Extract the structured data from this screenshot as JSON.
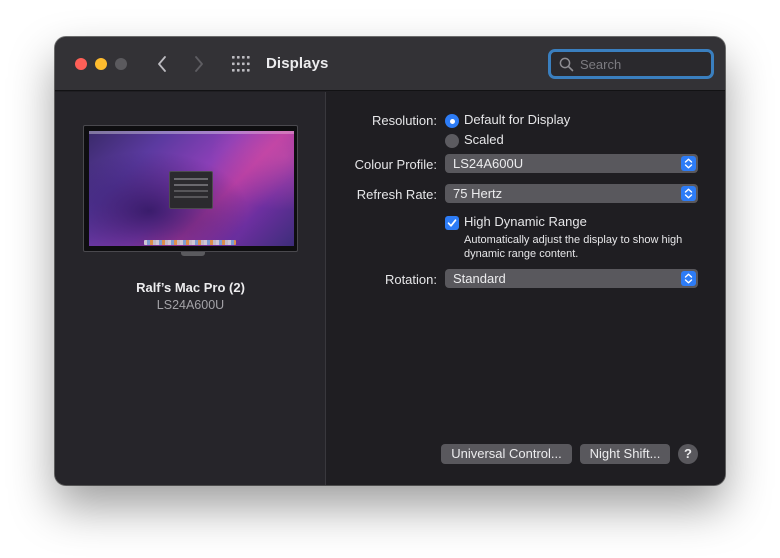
{
  "window": {
    "title": "Displays",
    "search": {
      "placeholder": "Search",
      "value": ""
    }
  },
  "icons": {
    "back": "chevron-left-icon",
    "forward": "chevron-right-icon",
    "grid": "grid-icon",
    "search": "search-icon",
    "popup": "updown-chevron-icon",
    "checkmark": "checkmark-icon"
  },
  "colors": {
    "accent": "#2d7cf6",
    "close": "#fe5f57",
    "minimize": "#febc2e",
    "zoom_disabled": "#5b5a5e",
    "search_focus": "#3a7fbf"
  },
  "display": {
    "name": "Ralf’s Mac Pro (2)",
    "model": "LS24A600U"
  },
  "settings": {
    "resolution": {
      "label": "Resolution:",
      "options": [
        {
          "label": "Default for Display",
          "selected": true
        },
        {
          "label": "Scaled",
          "selected": false
        }
      ]
    },
    "colour_profile": {
      "label": "Colour Profile:",
      "value": "LS24A600U"
    },
    "refresh_rate": {
      "label": "Refresh Rate:",
      "value": "75 Hertz"
    },
    "hdr": {
      "label": "High Dynamic Range",
      "checked": true,
      "description": "Automatically adjust the display to show high dynamic range content."
    },
    "rotation": {
      "label": "Rotation:",
      "value": "Standard"
    }
  },
  "buttons": {
    "universal_control": "Universal Control...",
    "night_shift": "Night Shift...",
    "help": "?"
  }
}
